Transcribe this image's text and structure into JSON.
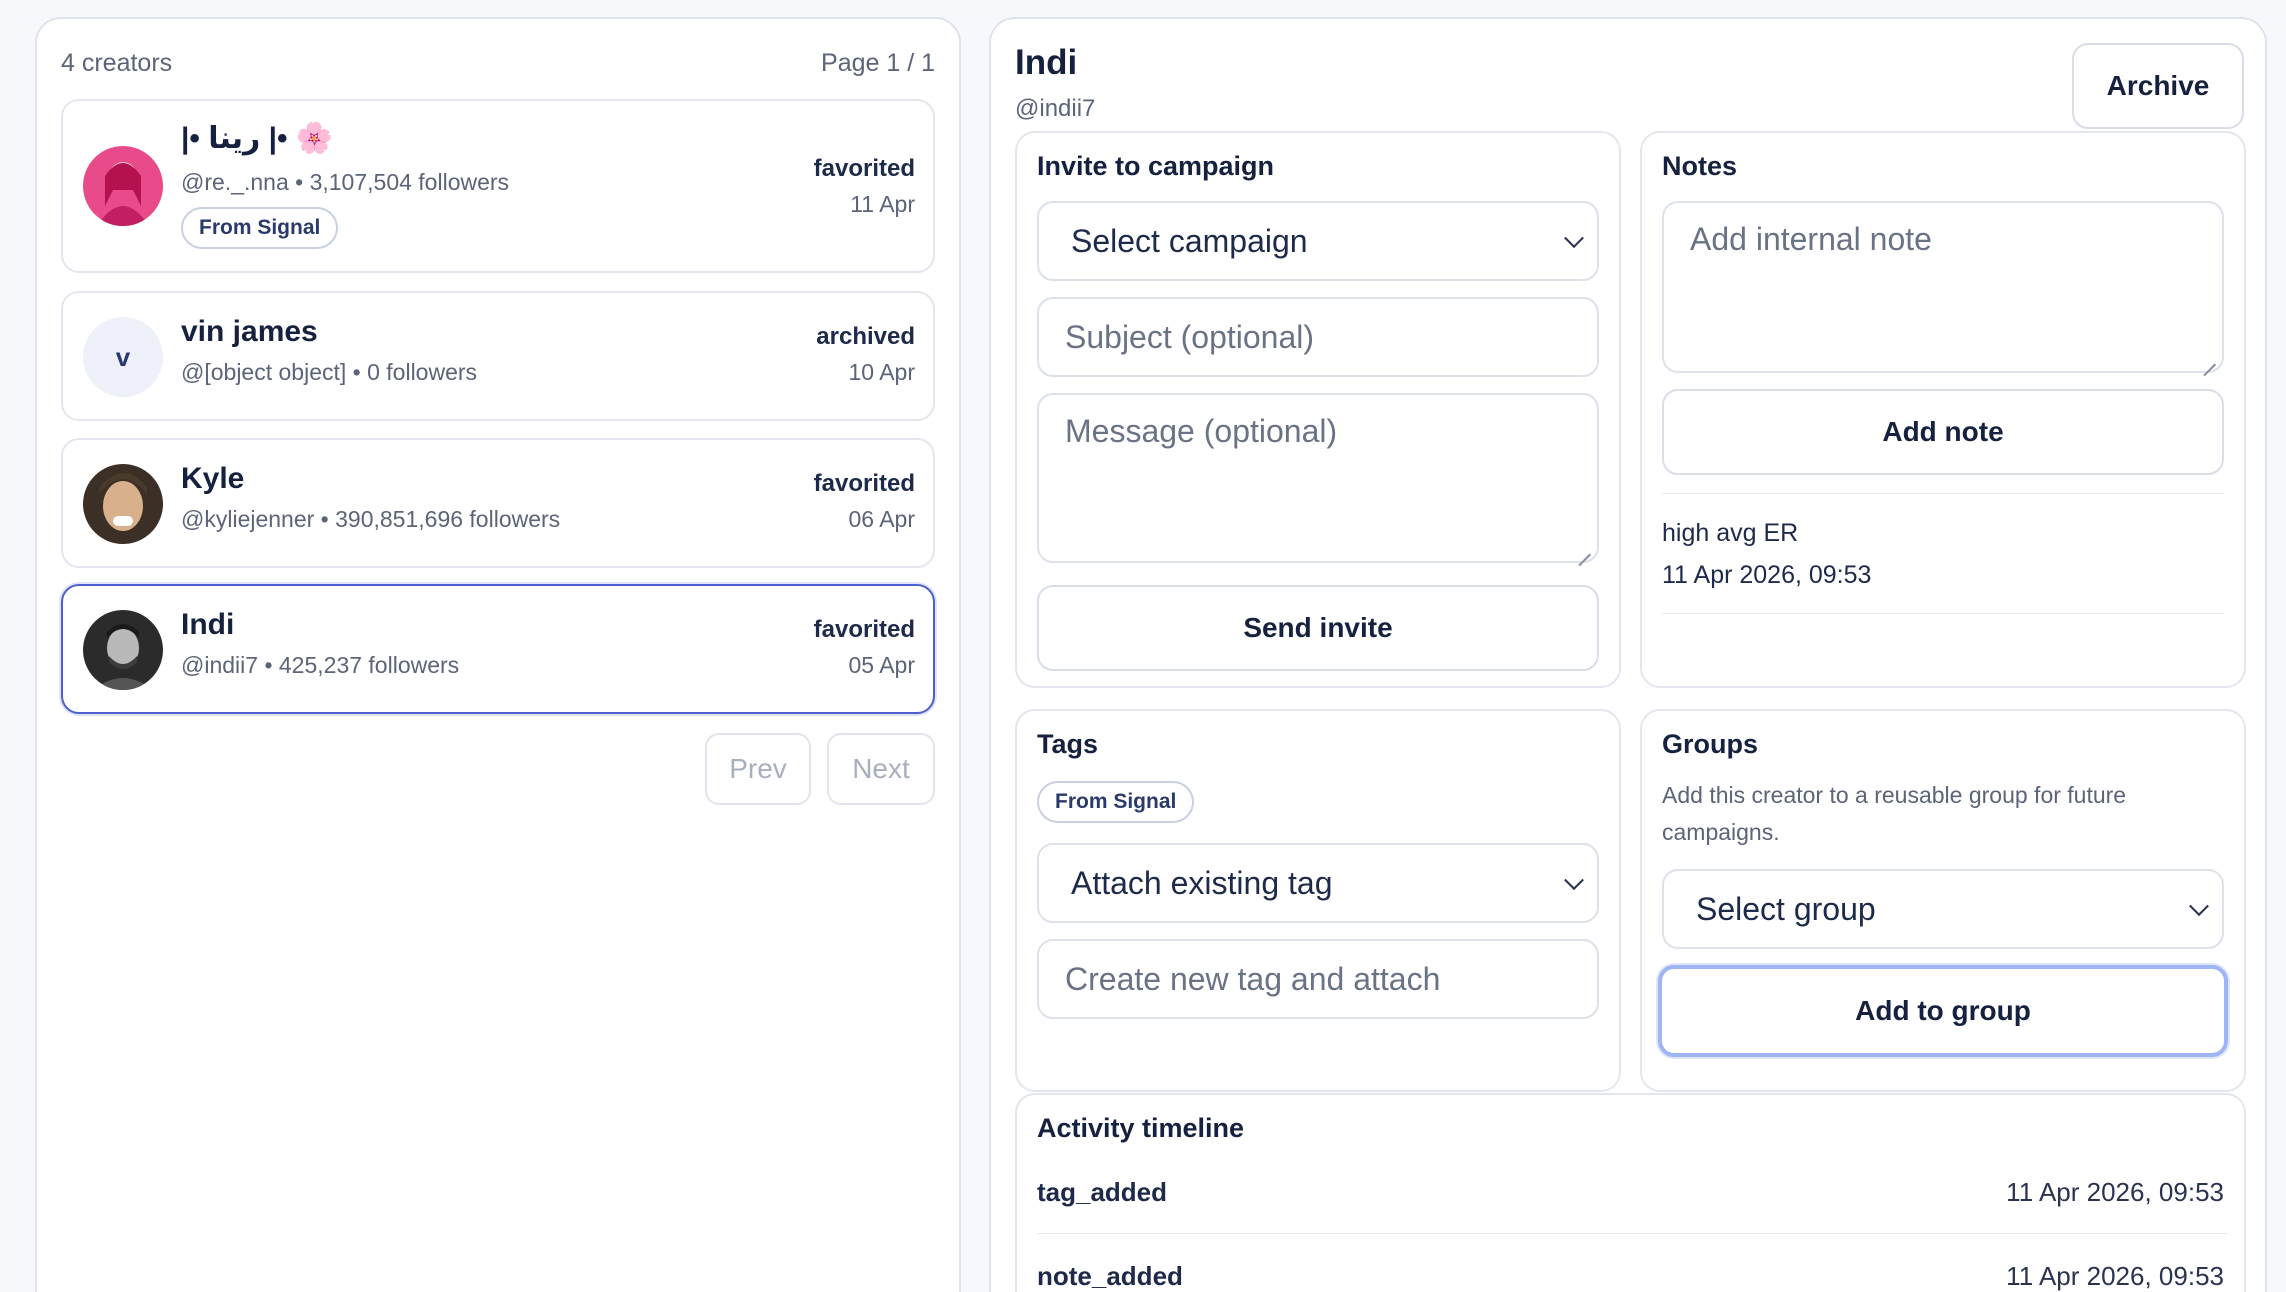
{
  "list": {
    "count_label": "4 creators",
    "page_label": "Page 1 / 1",
    "creators": [
      {
        "name": "|• رينا |• 🌸",
        "handle": "@re._.nna • 3,107,504 followers",
        "status": "favorited",
        "date": "11 Apr",
        "tag": "From Signal",
        "avatar": "pink-portrait"
      },
      {
        "name": "vin james",
        "handle": "@[object object] • 0 followers",
        "status": "archived",
        "date": "10 Apr",
        "avatar_letter": "v"
      },
      {
        "name": "Kyle",
        "handle": "@kyliejenner • 390,851,696 followers",
        "status": "favorited",
        "date": "06 Apr",
        "avatar": "portrait"
      },
      {
        "name": "Indi",
        "handle": "@indii7 • 425,237 followers",
        "status": "favorited",
        "date": "05 Apr",
        "avatar": "bw-portrait"
      }
    ],
    "prev_label": "Prev",
    "next_label": "Next"
  },
  "detail": {
    "name": "Indi",
    "handle": "@indii7",
    "archive_label": "Archive",
    "invite": {
      "title": "Invite to campaign",
      "campaign_select": "Select campaign",
      "subject_placeholder": "Subject (optional)",
      "message_placeholder": "Message (optional)",
      "send_label": "Send invite"
    },
    "notes": {
      "title": "Notes",
      "placeholder": "Add internal note",
      "add_label": "Add note",
      "entries": [
        {
          "text": "high avg ER",
          "time": "11 Apr 2026, 09:53"
        }
      ]
    },
    "tags": {
      "title": "Tags",
      "items": [
        "From Signal"
      ],
      "attach_select": "Attach existing tag",
      "create_placeholder": "Create new tag and attach"
    },
    "groups": {
      "title": "Groups",
      "description_line1": "Add this creator to a reusable group for future",
      "description_line2": "campaigns.",
      "group_select": "Select group",
      "add_label": "Add to group"
    },
    "timeline": {
      "title": "Activity timeline",
      "events": [
        {
          "event": "tag_added",
          "time": "11 Apr 2026, 09:53"
        },
        {
          "event": "note_added",
          "time": "11 Apr 2026, 09:53"
        }
      ]
    }
  },
  "colors": {
    "accent": "#4b5fcf",
    "focus_ring": "#9fb4f3",
    "text_dark": "#16213f",
    "text_muted": "#5b6478",
    "border": "#dfe3ec"
  }
}
